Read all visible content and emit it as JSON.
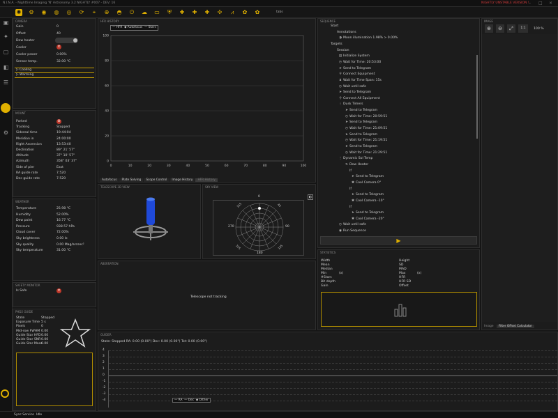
{
  "window": {
    "title": "N.I.N.A. - Nighttime Imaging 'N' Astronomy 3.2 NIGHTLY #007   -   DEV: 16",
    "warning": "NIGHTLY UNSTABLE VERSION !"
  },
  "toolbar": {
    "icons": [
      "sun-icon",
      "gear-icon",
      "camera-icon",
      "filter-icon",
      "focuser-icon",
      "rotator-icon",
      "telescope-icon",
      "guider-icon",
      "dome-icon",
      "switch-icon",
      "weather-icon",
      "flat-icon",
      "safety-icon",
      "plugin-icon",
      "plugin-icon",
      "plugin-icon",
      "puzzle-icon",
      "chart-icon",
      "dsr-icon",
      "dsr-icon"
    ],
    "tab_label": "tabs"
  },
  "sidebar": {
    "items": [
      "Equip",
      "Sky Atlas",
      "Framing",
      "Flat Wiz",
      "Sequencer",
      "Imaging",
      "Options"
    ]
  },
  "camera": {
    "title": "CAMERA",
    "rows": [
      [
        "Gain",
        "0"
      ],
      [
        "Offset",
        "40"
      ],
      [
        "Dew heater",
        "ON"
      ],
      [
        "Cooler",
        ""
      ],
      [
        "Cooler power",
        "0.00%"
      ],
      [
        "Sensor temp.",
        "32.00 °C"
      ]
    ],
    "cooling": "Cooling",
    "warming": "Warming"
  },
  "mount": {
    "title": "MOUNT",
    "rows": [
      [
        "Parked",
        ""
      ],
      [
        "Tracking",
        "Stopped"
      ],
      [
        "Sidereal time",
        "19:44:04"
      ],
      [
        "Meridian in",
        "24:00:00"
      ],
      [
        "Right Ascension",
        "13:53:40"
      ],
      [
        "Declination",
        "89° 21' 57\""
      ],
      [
        "Altitude",
        "37° 10' 57\""
      ],
      [
        "Azimuth",
        "358° 03' 37\""
      ],
      [
        "Side of pier",
        "East"
      ],
      [
        "RA guide rate",
        "7.520"
      ],
      [
        "Dec guide rate",
        "7.520"
      ]
    ]
  },
  "weather": {
    "title": "WEATHER",
    "rows": [
      [
        "Temperature",
        "25.98 °C"
      ],
      [
        "Humidity",
        "52.00%"
      ],
      [
        "Dew point",
        "16.77 °C"
      ],
      [
        "Pressure",
        "938.57 hPa"
      ],
      [
        "Cloud cover",
        "72.00%"
      ],
      [
        "Sky brightness",
        "0.00 lx"
      ],
      [
        "Sky quality",
        "0.00 Mag/arcsec²"
      ],
      [
        "Sky temperature",
        "31.00 °C"
      ]
    ]
  },
  "safety": {
    "title": "SAFETY MONITOR",
    "label": "Is Safe"
  },
  "phd2": {
    "title": "PHD2 GUIDE",
    "rows": [
      [
        "State",
        "Stopped"
      ],
      [
        "Exposure Time",
        "5 s"
      ],
      [
        "Pixels",
        "0"
      ],
      [
        "Mid-row FWHM",
        "0.00"
      ],
      [
        "Guide Star HFD",
        "0.00"
      ],
      [
        "Guide Star SNR",
        "0.00"
      ],
      [
        "Guide Star Mass",
        "0.00"
      ]
    ]
  },
  "hfr_panel": {
    "title": "HFR HISTORY",
    "legend": [
      "HFR",
      "Autofocus",
      "Stars"
    ],
    "tabs": [
      "Autofocus",
      "Plate Solving",
      "Scope Control",
      "Image History",
      "HFR History"
    ]
  },
  "hfr_chart": {
    "type": "line",
    "xlabel": "",
    "ylabel": "",
    "xlim": [
      0,
      100
    ],
    "ylim": [
      0,
      100
    ],
    "xticks": [
      0,
      10,
      20,
      30,
      40,
      50,
      60,
      70,
      80,
      90,
      100
    ],
    "yticks": [
      0,
      20,
      40,
      60,
      80,
      100
    ],
    "series": []
  },
  "telescope3d": {
    "title": "TELESCOPE 3D VIEW"
  },
  "skyview": {
    "title": "SKY VIEW",
    "n": "0",
    "e": "90",
    "s": "180",
    "w": "270",
    "tl": "315",
    "tr": "45",
    "bl": "225",
    "br": "135"
  },
  "aberration": {
    "title": "ABERRATION",
    "status": "Telescope not tracking"
  },
  "sequence": {
    "title": "SEQUENCE",
    "items": [
      {
        "lvl": 0,
        "icon": "",
        "text": "Start"
      },
      {
        "lvl": 1,
        "icon": "",
        "text": "Annotations"
      },
      {
        "lvl": 2,
        "icon": "◑",
        "text": "Moon illumination   1.98%  > 0.00%"
      },
      {
        "lvl": 0,
        "icon": "",
        "text": "Targets"
      },
      {
        "lvl": 1,
        "icon": "",
        "text": "Session"
      },
      {
        "lvl": 2,
        "icon": "▤",
        "text": "Initialize System"
      },
      {
        "lvl": 2,
        "icon": "◷",
        "text": "Wait for Time: 20:53:00"
      },
      {
        "lvl": 2,
        "icon": "➤",
        "text": "Send to Telegram"
      },
      {
        "lvl": 2,
        "icon": "⚲",
        "text": "Connect Equipment"
      },
      {
        "lvl": 2,
        "icon": "⧗",
        "text": "Wait for Time Span: 15s"
      },
      {
        "lvl": 2,
        "icon": "◷",
        "text": "Wait until safe"
      },
      {
        "lvl": 2,
        "icon": "➤",
        "text": "Send to Telegram"
      },
      {
        "lvl": 2,
        "icon": "⚲",
        "text": "Connect All Equipment"
      },
      {
        "lvl": 2,
        "icon": "⋮",
        "text": "Dusk Timers"
      },
      {
        "lvl": 3,
        "icon": "➤",
        "text": "Send to Telegram"
      },
      {
        "lvl": 3,
        "icon": "◷",
        "text": "Wait for Time: 20:59:51"
      },
      {
        "lvl": 3,
        "icon": "➤",
        "text": "Send to Telegram"
      },
      {
        "lvl": 3,
        "icon": "◷",
        "text": "Wait for Time: 21:09:51"
      },
      {
        "lvl": 3,
        "icon": "➤",
        "text": "Send to Telegram"
      },
      {
        "lvl": 3,
        "icon": "◷",
        "text": "Wait for Time: 21:19:51"
      },
      {
        "lvl": 3,
        "icon": "➤",
        "text": "Send to Telegram"
      },
      {
        "lvl": 3,
        "icon": "◷",
        "text": "Wait for Time: 21:29:51"
      },
      {
        "lvl": 2,
        "icon": "⋮",
        "text": "Dynamic Sol Temp"
      },
      {
        "lvl": 3,
        "icon": "↻",
        "text": "Dew Heater"
      },
      {
        "lvl": 3,
        "icon": "",
        "text": "If"
      },
      {
        "lvl": 4,
        "icon": "➤",
        "text": "Send to Telegram"
      },
      {
        "lvl": 4,
        "icon": "✱",
        "text": "Cool Camera  0°"
      },
      {
        "lvl": 3,
        "icon": "",
        "text": "If"
      },
      {
        "lvl": 4,
        "icon": "➤",
        "text": "Send to Telegram"
      },
      {
        "lvl": 4,
        "icon": "✱",
        "text": "Cool Camera  -10°"
      },
      {
        "lvl": 3,
        "icon": "",
        "text": "If"
      },
      {
        "lvl": 4,
        "icon": "➤",
        "text": "Send to Telegram"
      },
      {
        "lvl": 4,
        "icon": "✱",
        "text": "Cool Camera  -20°"
      },
      {
        "lvl": 2,
        "icon": "◷",
        "text": "Wait until safe"
      },
      {
        "lvl": 2,
        "icon": "◉",
        "text": "Run Sequence"
      }
    ],
    "play": "▶"
  },
  "stats": {
    "title": "STATISTICS",
    "left": [
      [
        "Width",
        ""
      ],
      [
        "Mean",
        ""
      ],
      [
        "Median",
        ""
      ],
      [
        "Min",
        "(x)"
      ],
      [
        "#Stars",
        ""
      ],
      [
        "Bit depth",
        ""
      ],
      [
        "Gain",
        ""
      ]
    ],
    "right": [
      [
        "Height",
        ""
      ],
      [
        "SD",
        ""
      ],
      [
        "MAD",
        ""
      ],
      [
        "Max",
        "(x)"
      ],
      [
        "HFR",
        ""
      ],
      [
        "HFR SD",
        ""
      ],
      [
        "Offset",
        ""
      ]
    ]
  },
  "image": {
    "title": "IMAGE",
    "zoom_fit": "1:1",
    "zoom": "100 %",
    "tabs": [
      "Image",
      "Filter Offset Calculator"
    ]
  },
  "guider": {
    "title": "GUIDER",
    "status": "State: Stopped  RA: 0.00 (0.00\")  Dec: 0.00 (0.00\")  Tot: 0.00 (0.00\")",
    "yticks": [
      "4",
      "3",
      "2",
      "1",
      "0",
      "-1",
      "-2",
      "-3",
      "-4"
    ],
    "legend": [
      "RA",
      "Dec",
      "Dither"
    ]
  },
  "statusbar": {
    "service": "Sync Service",
    "state": "Idle"
  }
}
